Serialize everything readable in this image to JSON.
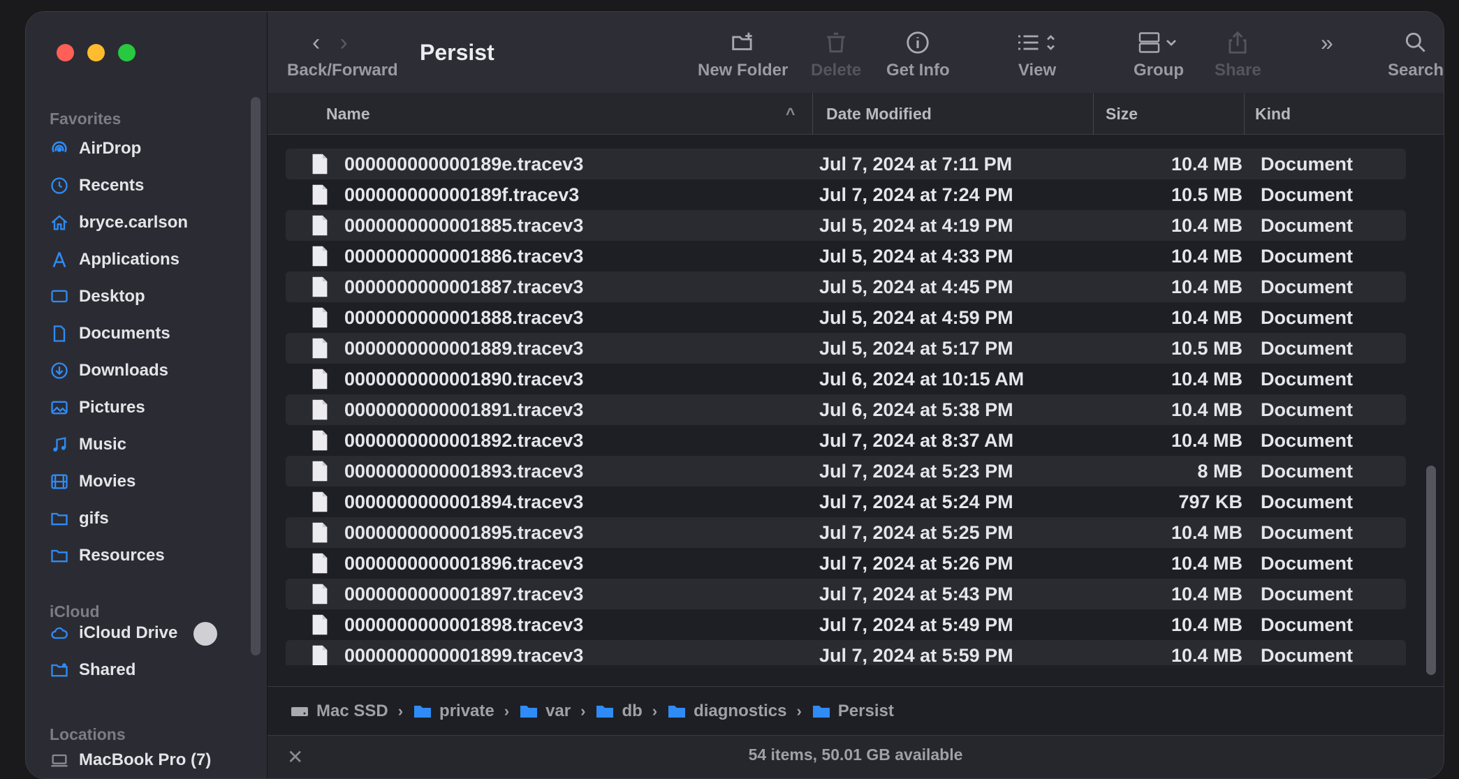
{
  "window": {
    "title": "Persist"
  },
  "toolbar": {
    "back_forward_label": "Back/Forward",
    "new_folder_label": "New Folder",
    "delete_label": "Delete",
    "get_info_label": "Get Info",
    "view_label": "View",
    "group_label": "Group",
    "share_label": "Share",
    "search_label": "Search"
  },
  "sidebar": {
    "favorites_header": "Favorites",
    "favorites": [
      {
        "label": "AirDrop",
        "icon": "airdrop-icon"
      },
      {
        "label": "Recents",
        "icon": "clock-icon"
      },
      {
        "label": "bryce.carlson",
        "icon": "home-icon"
      },
      {
        "label": "Applications",
        "icon": "applications-icon"
      },
      {
        "label": "Desktop",
        "icon": "desktop-icon"
      },
      {
        "label": "Documents",
        "icon": "document-icon"
      },
      {
        "label": "Downloads",
        "icon": "download-icon"
      },
      {
        "label": "Pictures",
        "icon": "pictures-icon"
      },
      {
        "label": "Music",
        "icon": "music-icon"
      },
      {
        "label": "Movies",
        "icon": "movies-icon"
      },
      {
        "label": "gifs",
        "icon": "folder-icon"
      },
      {
        "label": "Resources",
        "icon": "folder-icon"
      }
    ],
    "icloud_header": "iCloud",
    "icloud": [
      {
        "label": "iCloud Drive",
        "icon": "cloud-icon"
      },
      {
        "label": "Shared",
        "icon": "shared-folder-icon"
      }
    ],
    "locations_header": "Locations",
    "locations": [
      {
        "label": "MacBook Pro (7)",
        "icon": "laptop-icon"
      }
    ]
  },
  "columns": {
    "name": "Name",
    "date_modified": "Date Modified",
    "size": "Size",
    "kind": "Kind"
  },
  "files": [
    {
      "name": "000000000000189e.tracev3",
      "date": "Jul 7, 2024 at 7:11 PM",
      "size": "10.4 MB",
      "kind": "Document"
    },
    {
      "name": "000000000000189f.tracev3",
      "date": "Jul 7, 2024 at 7:24 PM",
      "size": "10.5 MB",
      "kind": "Document"
    },
    {
      "name": "0000000000001885.tracev3",
      "date": "Jul 5, 2024 at 4:19 PM",
      "size": "10.4 MB",
      "kind": "Document"
    },
    {
      "name": "0000000000001886.tracev3",
      "date": "Jul 5, 2024 at 4:33 PM",
      "size": "10.4 MB",
      "kind": "Document"
    },
    {
      "name": "0000000000001887.tracev3",
      "date": "Jul 5, 2024 at 4:45 PM",
      "size": "10.4 MB",
      "kind": "Document"
    },
    {
      "name": "0000000000001888.tracev3",
      "date": "Jul 5, 2024 at 4:59 PM",
      "size": "10.4 MB",
      "kind": "Document"
    },
    {
      "name": "0000000000001889.tracev3",
      "date": "Jul 5, 2024 at 5:17 PM",
      "size": "10.5 MB",
      "kind": "Document"
    },
    {
      "name": "0000000000001890.tracev3",
      "date": "Jul 6, 2024 at 10:15 AM",
      "size": "10.4 MB",
      "kind": "Document"
    },
    {
      "name": "0000000000001891.tracev3",
      "date": "Jul 6, 2024 at 5:38 PM",
      "size": "10.4 MB",
      "kind": "Document"
    },
    {
      "name": "0000000000001892.tracev3",
      "date": "Jul 7, 2024 at 8:37 AM",
      "size": "10.4 MB",
      "kind": "Document"
    },
    {
      "name": "0000000000001893.tracev3",
      "date": "Jul 7, 2024 at 5:23 PM",
      "size": "8 MB",
      "kind": "Document"
    },
    {
      "name": "0000000000001894.tracev3",
      "date": "Jul 7, 2024 at 5:24 PM",
      "size": "797 KB",
      "kind": "Document"
    },
    {
      "name": "0000000000001895.tracev3",
      "date": "Jul 7, 2024 at 5:25 PM",
      "size": "10.4 MB",
      "kind": "Document"
    },
    {
      "name": "0000000000001896.tracev3",
      "date": "Jul 7, 2024 at 5:26 PM",
      "size": "10.4 MB",
      "kind": "Document"
    },
    {
      "name": "0000000000001897.tracev3",
      "date": "Jul 7, 2024 at 5:43 PM",
      "size": "10.4 MB",
      "kind": "Document"
    },
    {
      "name": "0000000000001898.tracev3",
      "date": "Jul 7, 2024 at 5:49 PM",
      "size": "10.4 MB",
      "kind": "Document"
    },
    {
      "name": "0000000000001899.tracev3",
      "date": "Jul 7, 2024 at 5:59 PM",
      "size": "10.4 MB",
      "kind": "Document"
    }
  ],
  "path": [
    "Mac SSD",
    "private",
    "var",
    "db",
    "diagnostics",
    "Persist"
  ],
  "status": {
    "text": "54 items, 50.01 GB available"
  },
  "colors": {
    "accent": "#2f8bf5",
    "window_bg": "#1e1f24",
    "sidebar_bg": "#2b2c33"
  }
}
